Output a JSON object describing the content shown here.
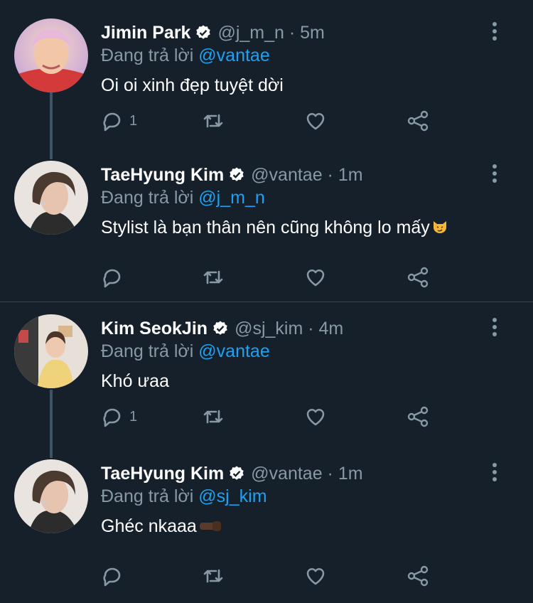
{
  "colors": {
    "background": "#15202b",
    "secondary_text": "#8899a6",
    "mention": "#1da1f2",
    "divider": "#38444d",
    "thread_line": "#3d5466"
  },
  "tweets": [
    {
      "name": "Jimin Park",
      "handle": "@j_m_n · 5m",
      "replying_prefix": "Đang trả lời",
      "replying_to": "@vantae",
      "text": "Oi oi xinh đẹp tuyệt dời",
      "reply_count": "1",
      "verified": true
    },
    {
      "name": "TaeHyung Kim",
      "handle": "@vantae · 1m",
      "replying_prefix": "Đang trả lời",
      "replying_to": "@j_m_n",
      "text": "Stylist là bạn thân nên cũng không lo mấy",
      "emoji_icon": "smirking-cat-emoji",
      "reply_count": "",
      "verified": true
    },
    {
      "name": "Kim SeokJin",
      "handle": "@sj_kim · 4m",
      "replying_prefix": "Đang trả lời",
      "replying_to": "@vantae",
      "text": "Khó ưaa",
      "reply_count": "1",
      "verified": true
    },
    {
      "name": "TaeHyung Kim",
      "handle": "@vantae · 1m",
      "replying_prefix": "Đang trả lời",
      "replying_to": "@sj_kim",
      "text": "Ghéc nkaaa",
      "emoji_icon": "fist-bump-emoji",
      "reply_count": "",
      "verified": true
    }
  ],
  "icons": {
    "reply": "reply-icon",
    "retweet": "retweet-icon",
    "like": "heart-icon",
    "share": "share-icon",
    "more": "more-vertical-icon",
    "verified": "verified-badge-icon"
  }
}
